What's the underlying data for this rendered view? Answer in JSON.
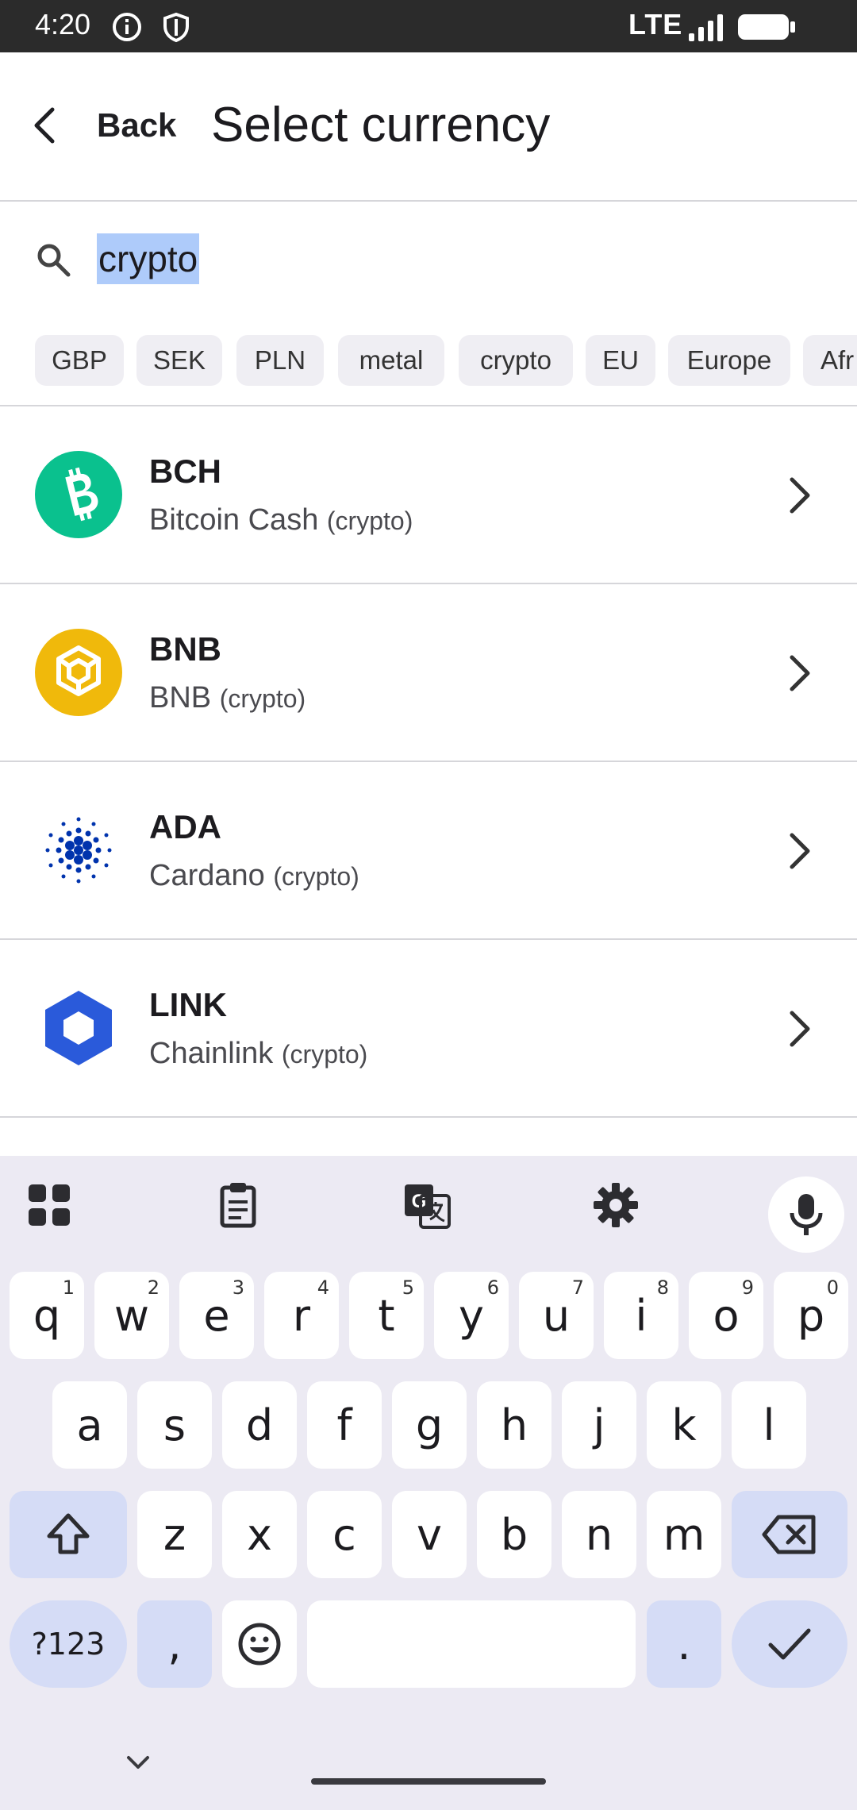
{
  "status_bar": {
    "time": "4:20",
    "network": "LTE"
  },
  "app_bar": {
    "back_label": "Back",
    "title": "Select currency"
  },
  "search": {
    "value": "crypto"
  },
  "chips": [
    "GBP",
    "SEK",
    "PLN",
    "metal",
    "crypto",
    "EU",
    "Europe",
    "Afr"
  ],
  "currencies": [
    {
      "code": "BCH",
      "name": "Bitcoin Cash",
      "tag": "(crypto)",
      "icon": "bitcoin-cash-icon",
      "color": "#0ac18e"
    },
    {
      "code": "BNB",
      "name": "BNB",
      "tag": "(crypto)",
      "icon": "bnb-icon",
      "color": "#f0b90b"
    },
    {
      "code": "ADA",
      "name": "Cardano",
      "tag": "(crypto)",
      "icon": "cardano-icon",
      "color": "#0033ad"
    },
    {
      "code": "LINK",
      "name": "Chainlink",
      "tag": "(crypto)",
      "icon": "chainlink-icon",
      "color": "#2a5ada"
    }
  ],
  "keyboard": {
    "row1": [
      {
        "k": "q",
        "s": "1"
      },
      {
        "k": "w",
        "s": "2"
      },
      {
        "k": "e",
        "s": "3"
      },
      {
        "k": "r",
        "s": "4"
      },
      {
        "k": "t",
        "s": "5"
      },
      {
        "k": "y",
        "s": "6"
      },
      {
        "k": "u",
        "s": "7"
      },
      {
        "k": "i",
        "s": "8"
      },
      {
        "k": "o",
        "s": "9"
      },
      {
        "k": "p",
        "s": "0"
      }
    ],
    "row2": [
      "a",
      "s",
      "d",
      "f",
      "g",
      "h",
      "j",
      "k",
      "l"
    ],
    "row3": [
      "z",
      "x",
      "c",
      "v",
      "b",
      "n",
      "m"
    ],
    "symbols_label": "?123",
    "comma": ",",
    "period": "."
  }
}
